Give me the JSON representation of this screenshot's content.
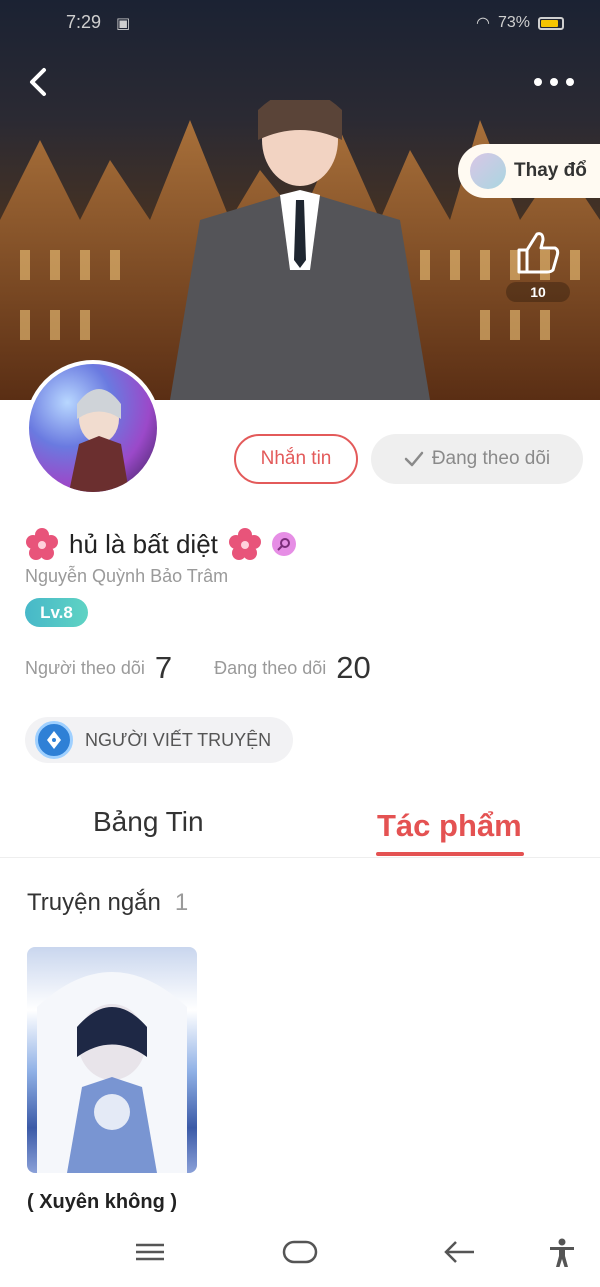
{
  "status_bar": {
    "time": "7:29",
    "battery": "73%"
  },
  "header": {
    "change_label": "Thay đổ",
    "like_count": "10"
  },
  "actions": {
    "message_label": "Nhắn tin",
    "following_label": "Đang theo dõi"
  },
  "profile": {
    "display_name": "hủ là bất diệt",
    "full_name": "Nguyễn Quỳnh Bảo Trâm",
    "level": "Lv.8",
    "followers_label": "Người theo dõi",
    "followers_count": "7",
    "following_label": "Đang theo dõi",
    "following_count": "20",
    "role_badge": "NGƯỜI VIẾT TRUYỆN"
  },
  "tabs": [
    {
      "label": "Bảng Tin",
      "active": false
    },
    {
      "label": "Tác phẩm",
      "active": true
    }
  ],
  "works": {
    "section_label": "Truyện ngắn",
    "section_count": "1",
    "items": [
      {
        "title": "( Xuyên không )"
      }
    ]
  },
  "colors": {
    "accent": "#e45252",
    "level_badge": "#47b8c9",
    "following_bg": "#efefef"
  },
  "icons": [
    "back-icon",
    "more-icon",
    "thumbs-up-icon",
    "check-icon",
    "flower-icon",
    "female-icon",
    "pen-badge-icon",
    "menu-icon",
    "home-icon",
    "nav-back-icon",
    "accessibility-icon"
  ]
}
